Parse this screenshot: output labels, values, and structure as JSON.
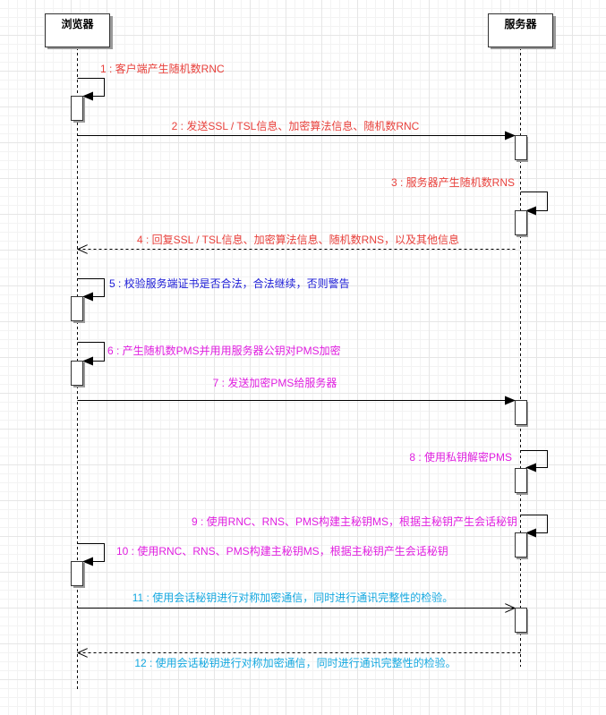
{
  "actors": {
    "browser": "浏览器",
    "server": "服务器"
  },
  "colors": {
    "red": "#e8413c",
    "blue": "#1a1ad6",
    "magenta": "#e020e0",
    "cyan": "#14a8e0"
  },
  "messages": [
    {
      "label": "1 : 客户端产生随机数RNC",
      "color": "#e8413c",
      "kind": "self",
      "side": "browser"
    },
    {
      "label": "2 : 发送SSL / TSL信息、加密算法信息、随机数RNC",
      "color": "#e8413c",
      "kind": "call",
      "dir": "right"
    },
    {
      "label": "3 : 服务器产生随机数RNS",
      "color": "#e8413c",
      "kind": "self",
      "side": "server"
    },
    {
      "label": "4 : 回复SSL / TSL信息、加密算法信息、随机数RNS，以及其他信息",
      "color": "#e8413c",
      "kind": "return",
      "dir": "left"
    },
    {
      "label": "5 : 校验服务端证书是否合法，合法继续，否则警告",
      "color": "#1a1ad6",
      "kind": "self",
      "side": "browser"
    },
    {
      "label": "6 : 产生随机数PMS并用用服务器公钥对PMS加密",
      "color": "#e020e0",
      "kind": "self",
      "side": "browser"
    },
    {
      "label": "7 : 发送加密PMS给服务器",
      "color": "#e020e0",
      "kind": "call",
      "dir": "right"
    },
    {
      "label": "8 : 使用私钥解密PMS",
      "color": "#e020e0",
      "kind": "self",
      "side": "server"
    },
    {
      "label": "9 : 使用RNC、RNS、PMS构建主秘钥MS，根据主秘钥产生会话秘钥",
      "color": "#e020e0",
      "kind": "self",
      "side": "server"
    },
    {
      "label": "10 : 使用RNC、RNS、PMS构建主秘钥MS，根据主秘钥产生会话秘钥",
      "color": "#e020e0",
      "kind": "self",
      "side": "browser"
    },
    {
      "label": "11 : 使用会话秘钥进行对称加密通信，同时进行通讯完整性的检验。",
      "color": "#14a8e0",
      "kind": "async",
      "dir": "right"
    },
    {
      "label": "12 : 使用会话秘钥进行对称加密通信，同时进行通讯完整性的检验。",
      "color": "#14a8e0",
      "kind": "return",
      "dir": "left"
    }
  ]
}
